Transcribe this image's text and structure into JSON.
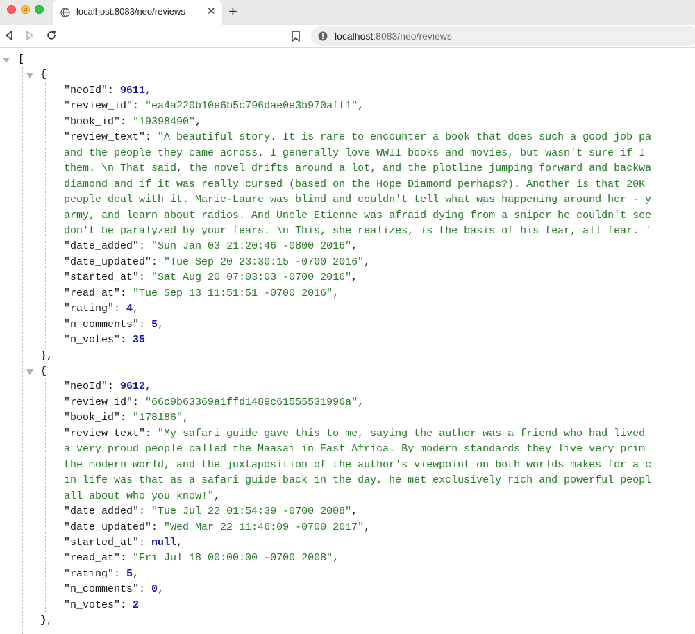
{
  "browser": {
    "tab_title": "localhost:8083/neo/reviews",
    "url_host": "localhost",
    "url_rest": ":8083/neo/reviews"
  },
  "json": {
    "open_bracket": "[",
    "records": [
      {
        "open": "{",
        "close": "},",
        "fields": [
          {
            "key": "\"neoId\"",
            "sep": ": ",
            "value": "9611",
            "type": "num",
            "comma": ","
          },
          {
            "key": "\"review_id\"",
            "sep": ": ",
            "value": "\"ea4a220b10e6b5c796dae0e3b970aff1\"",
            "type": "str",
            "comma": ","
          },
          {
            "key": "\"book_id\"",
            "sep": ": ",
            "value": "\"19398490\"",
            "type": "str",
            "comma": ","
          },
          {
            "key": "\"review_text\"",
            "sep": ": ",
            "value": "\"A beautiful story. It is rare to encounter a book that does such a good job pa",
            "type": "str",
            "comma": ""
          },
          {
            "cont": "and the people they came across. I generally love WWII books and movies, but wasn't sure if I"
          },
          {
            "cont": "them. \\n That said, the novel drifts around a lot, and the plotline jumping forward and backwa"
          },
          {
            "cont": "diamond and if it was really cursed (based on the Hope Diamond perhaps?). Another is that 20K"
          },
          {
            "cont": "people deal with it. Marie-Laure was blind and couldn't tell what was happening around her - y"
          },
          {
            "cont": "army, and learn about radios. And Uncle Etienne was afraid dying from a sniper he couldn't see"
          },
          {
            "cont": "don't be paralyzed by your fears. \\n This, she realizes, is the basis of his fear, all fear. '"
          },
          {
            "key": "\"date_added\"",
            "sep": ": ",
            "value": "\"Sun Jan 03 21:20:46 -0800 2016\"",
            "type": "str",
            "comma": ","
          },
          {
            "key": "\"date_updated\"",
            "sep": ": ",
            "value": "\"Tue Sep 20 23:30:15 -0700 2016\"",
            "type": "str",
            "comma": ","
          },
          {
            "key": "\"started_at\"",
            "sep": ": ",
            "value": "\"Sat Aug 20 07:03:03 -0700 2016\"",
            "type": "str",
            "comma": ","
          },
          {
            "key": "\"read_at\"",
            "sep": ": ",
            "value": "\"Tue Sep 13 11:51:51 -0700 2016\"",
            "type": "str",
            "comma": ","
          },
          {
            "key": "\"rating\"",
            "sep": ": ",
            "value": "4",
            "type": "num",
            "comma": ","
          },
          {
            "key": "\"n_comments\"",
            "sep": ": ",
            "value": "5",
            "type": "num",
            "comma": ","
          },
          {
            "key": "\"n_votes\"",
            "sep": ": ",
            "value": "35",
            "type": "num",
            "comma": ""
          }
        ]
      },
      {
        "open": "{",
        "close": "},",
        "fields": [
          {
            "key": "\"neoId\"",
            "sep": ": ",
            "value": "9612",
            "type": "num",
            "comma": ","
          },
          {
            "key": "\"review_id\"",
            "sep": ": ",
            "value": "\"66c9b63369a1ffd1489c61555531996a\"",
            "type": "str",
            "comma": ","
          },
          {
            "key": "\"book_id\"",
            "sep": ": ",
            "value": "\"178186\"",
            "type": "str",
            "comma": ","
          },
          {
            "key": "\"review_text\"",
            "sep": ": ",
            "value": "\"My safari guide gave this to me, saying the author was a friend who had lived",
            "type": "str",
            "comma": ""
          },
          {
            "cont": "a very proud people called the Maasai in East Africa. By modern standards they live very prim"
          },
          {
            "cont": "the modern world, and the juxtaposition of the author's viewpoint on both worlds makes for a c"
          },
          {
            "cont": "in life was that as a safari guide back in the day, he met exclusively rich and powerful peopl"
          },
          {
            "cont": "all about who you know!\"",
            "comma": ","
          },
          {
            "key": "\"date_added\"",
            "sep": ": ",
            "value": "\"Tue Jul 22 01:54:39 -0700 2008\"",
            "type": "str",
            "comma": ","
          },
          {
            "key": "\"date_updated\"",
            "sep": ": ",
            "value": "\"Wed Mar 22 11:46:09 -0700 2017\"",
            "type": "str",
            "comma": ","
          },
          {
            "key": "\"started_at\"",
            "sep": ": ",
            "value": "null",
            "type": "nul",
            "comma": ","
          },
          {
            "key": "\"read_at\"",
            "sep": ": ",
            "value": "\"Fri Jul 18 00:00:00 -0700 2008\"",
            "type": "str",
            "comma": ","
          },
          {
            "key": "\"rating\"",
            "sep": ": ",
            "value": "5",
            "type": "num",
            "comma": ","
          },
          {
            "key": "\"n_comments\"",
            "sep": ": ",
            "value": "0",
            "type": "num",
            "comma": ","
          },
          {
            "key": "\"n_votes\"",
            "sep": ": ",
            "value": "2",
            "type": "num",
            "comma": ""
          }
        ]
      }
    ]
  },
  "colors": {
    "string": "#237a23",
    "number": "#1a1aa6",
    "key": "#1a1a1a"
  }
}
